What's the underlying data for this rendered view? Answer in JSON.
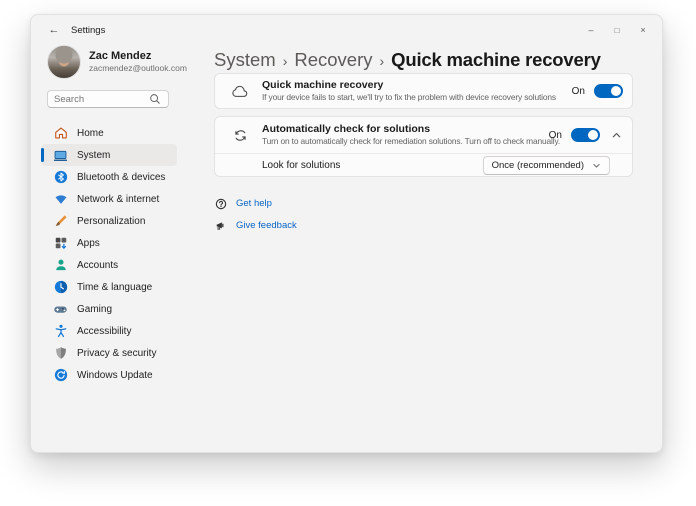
{
  "colors": {
    "accent": "#0067C0",
    "link": "#0A64C5",
    "window_bg": "#F3F3F3",
    "card_bg": "#FBFBFB"
  },
  "titlebar": {
    "back_icon": "←",
    "app_title": "Settings",
    "minimize_icon": "–",
    "maximize_icon": "□",
    "close_icon": "×"
  },
  "profile": {
    "name": "Zac Mendez",
    "email": "zacmendez@outlook.com"
  },
  "search": {
    "placeholder": "Search"
  },
  "sidebar": {
    "items": [
      {
        "label": "Home",
        "icon": "home-icon",
        "selected": false
      },
      {
        "label": "System",
        "icon": "system-icon",
        "selected": true
      },
      {
        "label": "Bluetooth & devices",
        "icon": "bluetooth-icon",
        "selected": false
      },
      {
        "label": "Network & internet",
        "icon": "network-icon",
        "selected": false
      },
      {
        "label": "Personalization",
        "icon": "personalization-icon",
        "selected": false
      },
      {
        "label": "Apps",
        "icon": "apps-icon",
        "selected": false
      },
      {
        "label": "Accounts",
        "icon": "accounts-icon",
        "selected": false
      },
      {
        "label": "Time & language",
        "icon": "time-language-icon",
        "selected": false
      },
      {
        "label": "Gaming",
        "icon": "gaming-icon",
        "selected": false
      },
      {
        "label": "Accessibility",
        "icon": "accessibility-icon",
        "selected": false
      },
      {
        "label": "Privacy & security",
        "icon": "privacy-security-icon",
        "selected": false
      },
      {
        "label": "Windows Update",
        "icon": "windows-update-icon",
        "selected": false
      }
    ]
  },
  "breadcrumb": {
    "level1": "System",
    "level2": "Recovery",
    "current": "Quick machine recovery",
    "separator": "›"
  },
  "cards": {
    "quick_recovery": {
      "icon": "cloud-icon",
      "title": "Quick machine recovery",
      "description": "If your device fails to start, we'll try to fix the problem with device recovery solutions",
      "toggle_label": "On",
      "toggle_state": "on"
    },
    "auto_check": {
      "icon": "sync-icon",
      "title": "Automatically check for solutions",
      "description": "Turn on to automatically check for remediation solutions. Turn off to check manually.",
      "toggle_label": "On",
      "toggle_state": "on",
      "expanded": true
    },
    "look_for_solutions": {
      "label": "Look for solutions",
      "value": "Once (recommended)"
    }
  },
  "links": {
    "get_help": "Get help",
    "give_feedback": "Give feedback"
  }
}
